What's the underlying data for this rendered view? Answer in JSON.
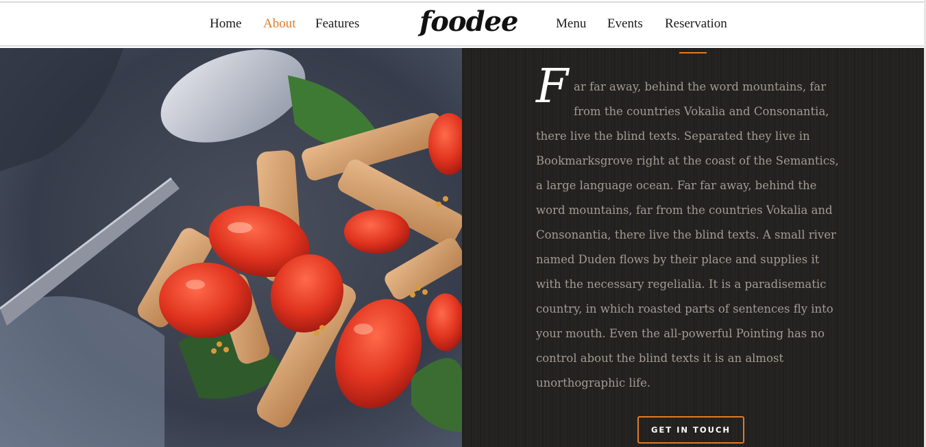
{
  "nav": {
    "left": [
      "Home",
      "About",
      "Features"
    ],
    "right": [
      "Menu",
      "Events",
      "Reservation"
    ],
    "active": "About",
    "accent_color": "#e07b28"
  },
  "brand": {
    "logo": "foodee"
  },
  "hero_image": {
    "icon": "pasta-tomato-salad-photo"
  },
  "about": {
    "dropcap": "F",
    "lines": [
      "ar far away, behind the word mountains, far",
      "from the countries Vokalia and Consonantia,",
      "there live the blind texts. Separated they live in",
      "Bookmarksgrove right at the coast of the Semantics,",
      "a large language ocean. Far far away, behind the",
      "word mountains, far from the countries Vokalia and",
      "Consonantia, there live the blind texts. A small river",
      "named Duden flows by their place and supplies it",
      "with the necessary regelialia. It is a paradisematic",
      "country, in which roasted parts of sentences fly into",
      "your mouth. Even the all-powerful Pointing has no",
      "control about the blind texts it is an almost",
      "unorthographic life."
    ],
    "cta_label": "GET IN TOUCH"
  }
}
